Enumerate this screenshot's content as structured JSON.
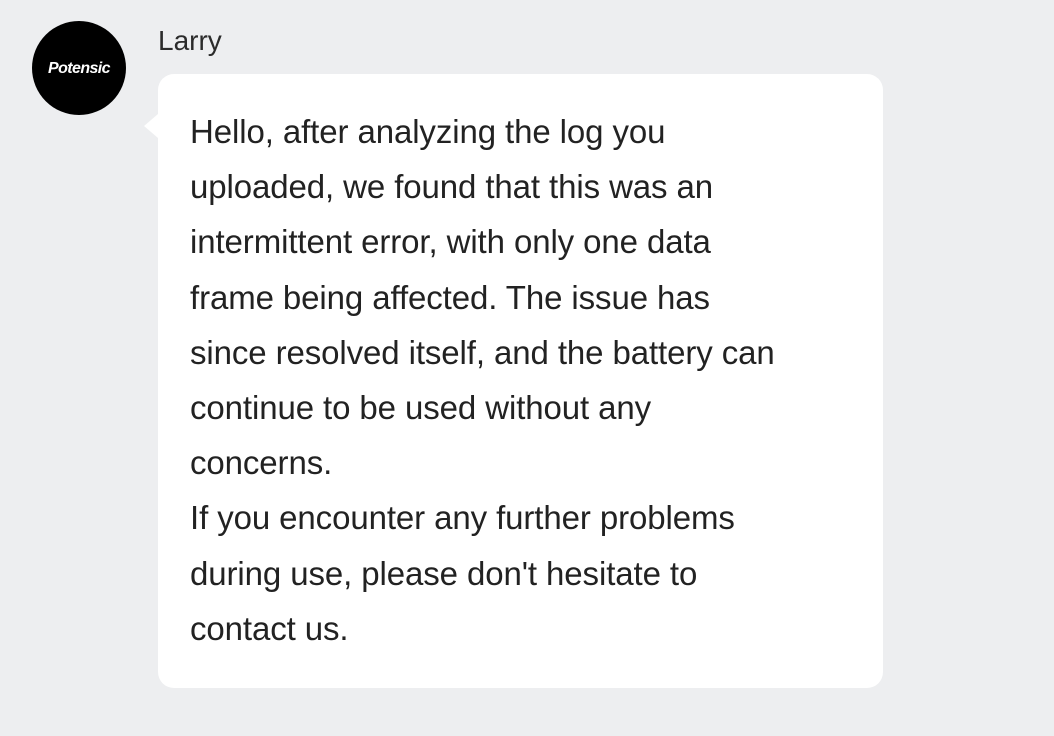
{
  "sender": {
    "name": "Larry",
    "avatar_logo_text": "Potensic",
    "avatar_icon": "potensic-logo-avatar"
  },
  "message": {
    "text": "Hello, after analyzing the log you\nuploaded, we found that this was an\nintermittent error, with only one data\nframe being affected. The issue has\nsince resolved itself, and the battery can\ncontinue to be used without any\nconcerns.\nIf you encounter any further problems\nduring use, please don't hesitate to\ncontact us."
  },
  "colors": {
    "background": "#edeef0",
    "bubble": "#ffffff",
    "avatar": "#000000",
    "text": "#222222"
  }
}
